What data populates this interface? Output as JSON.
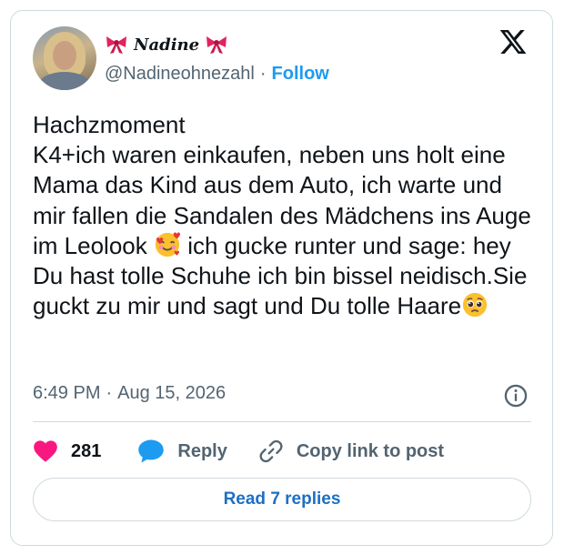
{
  "author": {
    "display_name": "Nadine",
    "handle": "@Nadineohnezahl",
    "follow_label": "Follow",
    "separator": "·"
  },
  "tweet": {
    "line_1": "Hachzmoment",
    "line_2": "K4+ich waren einkaufen, neben uns holt eine Mama das Kind aus dem Auto, ich warte und mir fallen die Sandalen des Mädchens ins Auge im Leolook ",
    "line_3": " ich gucke runter und sage: hey Du hast tolle Schuhe ich bin bissel neidisch.Sie guckt zu mir und sagt und Du tolle Haare",
    "emoji_1": "smiling-face-with-hearts",
    "emoji_2": "pleading-face"
  },
  "meta": {
    "time": "6:49 PM",
    "separator": "·",
    "date": "Aug 15, 2026"
  },
  "actions": {
    "like_count": "281",
    "reply_label": "Reply",
    "copy_label": "Copy link to post"
  },
  "read_replies_label": "Read 7 replies",
  "colors": {
    "accent": "#1d9bf0",
    "like": "#f91880",
    "bow": "#e0245e",
    "text": "#0f1419",
    "secondary": "#536471",
    "border": "#cfd9de"
  }
}
